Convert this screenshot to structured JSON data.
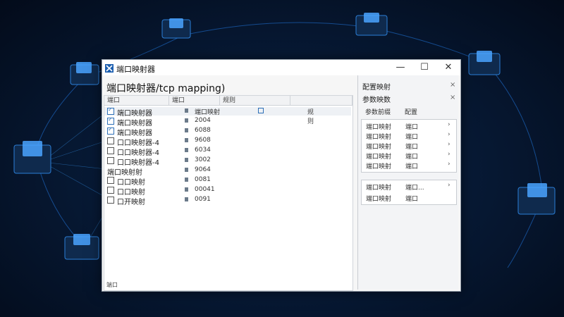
{
  "window": {
    "title": "端口映射器",
    "controls": [
      "—",
      "☐",
      "✕"
    ]
  },
  "header": {
    "title": "端口映射器/tcp mapping)"
  },
  "main": {
    "columns": [
      "端口",
      "端口",
      "规则",
      ""
    ],
    "extra_header": "规则",
    "rows": [
      {
        "name": "端口映射器",
        "checked": true,
        "port": "端口映射",
        "extra": "规则"
      },
      {
        "name": "端口映射器",
        "checked": true,
        "port": "2004",
        "extra": ""
      },
      {
        "name": "端口映射器",
        "checked": true,
        "port": "6088",
        "extra": ""
      },
      {
        "name": "口口映射器-4",
        "checked": false,
        "port": "9608",
        "extra": ""
      },
      {
        "name": "口口映射器-4",
        "checked": false,
        "port": "6034",
        "extra": ""
      },
      {
        "name": "口口映射器-4",
        "checked": false,
        "port": "3002",
        "extra": ""
      },
      {
        "name": "端口映射射",
        "checked": null,
        "port": "9064",
        "extra": ""
      },
      {
        "name": "口口映射",
        "checked": false,
        "port": "0081",
        "extra": ""
      },
      {
        "name": "口口映射",
        "checked": false,
        "port": "00041",
        "extra": ""
      },
      {
        "name": "口开映射",
        "checked": false,
        "port": "0091",
        "extra": ""
      }
    ]
  },
  "side": {
    "title": "配置映射",
    "close": "×",
    "subtitle": "参数映数",
    "first": {
      "label": "参数前缀",
      "value": "配置"
    },
    "group1": [
      {
        "label": "端口映射",
        "value": "端口"
      },
      {
        "label": "端口映射",
        "value": "端口"
      },
      {
        "label": "端口映射",
        "value": "端口"
      },
      {
        "label": "端口映射",
        "value": "端口"
      },
      {
        "label": "端口映射",
        "value": "端口"
      }
    ],
    "group2": [
      {
        "label": "端口映射",
        "value": "端口..."
      },
      {
        "label": "端口映射",
        "value": "端口"
      }
    ],
    "arrow": "›"
  },
  "status": {
    "text": "端口"
  },
  "colors": {
    "accent": "#2d6fb7",
    "bg": "#071a36"
  }
}
